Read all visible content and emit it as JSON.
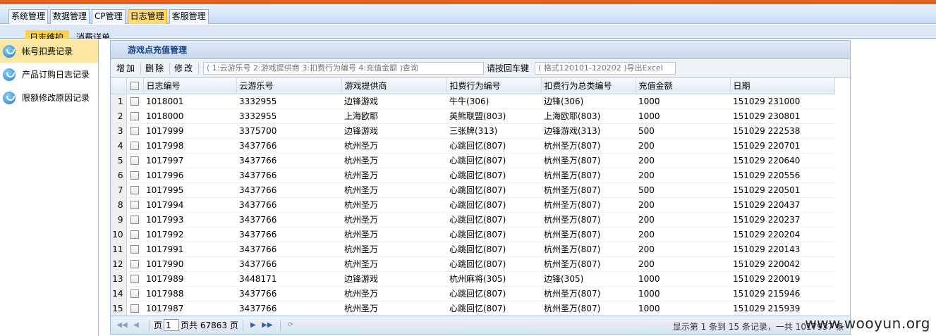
{
  "menu": [
    "系统管理",
    "数据管理",
    "CP管理",
    "日志管理",
    "客服管理"
  ],
  "subtabs": [
    "日志维护",
    "消费详单"
  ],
  "sidebar": [
    "帐号扣费记录",
    "产品订购日志记录",
    "限额修改原因记录"
  ],
  "panel_title": "游戏点充值管理",
  "toolbar": {
    "add": "增加",
    "delete": "删除",
    "edit": "修改",
    "query_placeholder": "( 1:云游乐号 2:游戏提供商 3:扣费行为编号 4:充值金额 )查询",
    "enter_hint": "请按回车键",
    "export_placeholder": "( 格式120101-120202 )导出Excel"
  },
  "columns": [
    "日志编号",
    "云游乐号",
    "游戏提供商",
    "扣费行为编号",
    "扣费行为总类编号",
    "充值金额",
    "日期"
  ],
  "rows": [
    [
      "1",
      "1018001",
      "3332955",
      "边锋游戏",
      "牛牛(306)",
      "边锋(306)",
      "1000",
      "151029 231000"
    ],
    [
      "2",
      "1018000",
      "3332955",
      "上海欧耶",
      "英熊联盟(803)",
      "上海欧耶(803)",
      "1000",
      "151029 230801"
    ],
    [
      "3",
      "1017999",
      "3375700",
      "边锋游戏",
      "三张牌(313)",
      "边锋游戏(313)",
      "500",
      "151029 222538"
    ],
    [
      "4",
      "1017998",
      "3437766",
      "杭州圣万",
      "心跳回忆(807)",
      "杭州圣万(807)",
      "200",
      "151029 220701"
    ],
    [
      "5",
      "1017997",
      "3437766",
      "杭州圣万",
      "心跳回忆(807)",
      "杭州圣万(807)",
      "200",
      "151029 220640"
    ],
    [
      "6",
      "1017996",
      "3437766",
      "杭州圣万",
      "心跳回忆(807)",
      "杭州圣万(807)",
      "200",
      "151029 220556"
    ],
    [
      "7",
      "1017995",
      "3437766",
      "杭州圣万",
      "心跳回忆(807)",
      "杭州圣万(807)",
      "500",
      "151029 220501"
    ],
    [
      "8",
      "1017994",
      "3437766",
      "杭州圣万",
      "心跳回忆(807)",
      "杭州圣万(807)",
      "200",
      "151029 220437"
    ],
    [
      "9",
      "1017993",
      "3437766",
      "杭州圣万",
      "心跳回忆(807)",
      "杭州圣万(807)",
      "200",
      "151029 220237"
    ],
    [
      "10",
      "1017992",
      "3437766",
      "杭州圣万",
      "心跳回忆(807)",
      "杭州圣万(807)",
      "200",
      "151029 220204"
    ],
    [
      "11",
      "1017991",
      "3437766",
      "杭州圣万",
      "心跳回忆(807)",
      "杭州圣万(807)",
      "200",
      "151029 220143"
    ],
    [
      "12",
      "1017990",
      "3437766",
      "杭州圣万",
      "心跳回忆(807)",
      "杭州圣万(807)",
      "200",
      "151029 220042"
    ],
    [
      "13",
      "1017989",
      "3448171",
      "边锋游戏",
      "杭州麻将(305)",
      "边锋(305)",
      "1000",
      "151029 220019"
    ],
    [
      "14",
      "1017988",
      "3437766",
      "杭州圣万",
      "心跳回忆(807)",
      "杭州圣万(807)",
      "1000",
      "151029 215946"
    ],
    [
      "15",
      "1017987",
      "3437766",
      "杭州圣万",
      "心跳回忆(807)",
      "杭州圣万(807)",
      "1000",
      "151029 215939"
    ]
  ],
  "pager": {
    "page_label": "页",
    "page_value": "1",
    "total_pages": "页共 67863 页",
    "info": "显示第 1 条到 15 条记录，一共 1017937 条"
  },
  "watermark": "www.wooyun.org"
}
